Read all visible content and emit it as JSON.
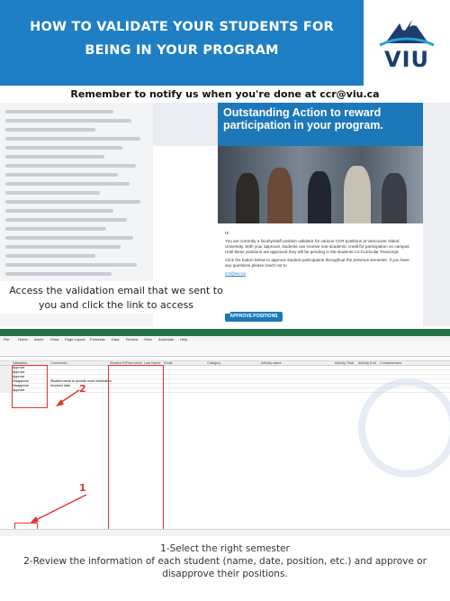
{
  "header": {
    "title_line1": "HOW TO VALIDATE YOUR STUDENTS FOR",
    "title_line2": "BEING IN YOUR PROGRAM",
    "logo_text": "VIU",
    "colors": {
      "band": "#1f7fc4",
      "logo_text": "#1b3e6b"
    }
  },
  "reminder": "Remember to notify us when you're done at ccr@viu.ca",
  "email": {
    "banner_title": "Outstanding Action to reward participation in your program.",
    "greeting": "Hi",
    "body_para1": "You are currently a faculty/staff position validator for various CCR positions at Vancouver Island University. With your approval, students can receive non-academic credit for participation on campus. Until these positions are approved they will be pending in the students Co-Curricular Transcript.",
    "body_para2": "Click the button below to approve student participation throughout the previous semester. If you have any questions please reach out to",
    "contact": "ccr@viu.ca",
    "approve_button": "APPROVE POSITIONS"
  },
  "access_text": "Access the validation email that we sent to you and click the link to access",
  "sheet": {
    "tabs": [
      "File",
      "Home",
      "Insert",
      "Draw",
      "Page Layout",
      "Formulas",
      "Data",
      "Review",
      "View",
      "Automate",
      "Help"
    ],
    "columns": [
      "Validation",
      "Comments",
      "Student ID",
      "First name",
      "Last Name",
      "Email",
      "Category",
      "Activity name",
      "Activity Start",
      "Activity End",
      "Competencies"
    ],
    "dropdown_values": [
      "Approve",
      "Approve",
      "Approve",
      "Disapprove",
      "Disapprove",
      "Approve"
    ],
    "comment_values": [
      "",
      "",
      "",
      "Student needs to provide more information",
      "Incorrect date",
      ""
    ],
    "marker1": "1",
    "marker2": "2"
  },
  "instructions": {
    "step1": "1-Select the right semester",
    "step2": "2-Review the information of each student (name, date, position, etc.) and approve or disapprove their positions."
  }
}
